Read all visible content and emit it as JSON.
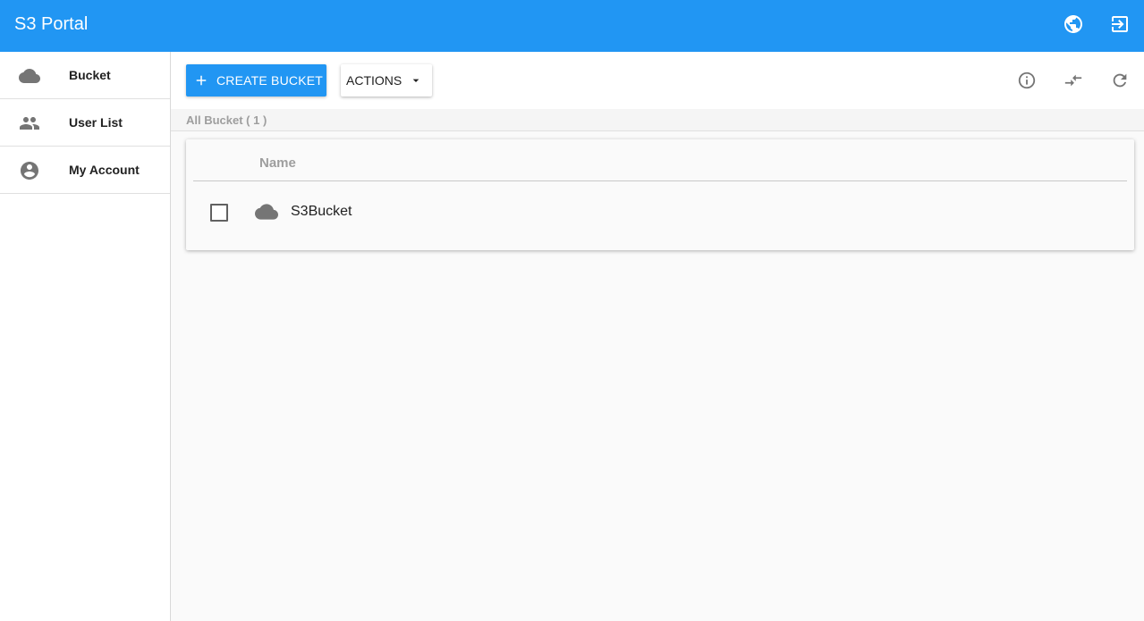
{
  "app": {
    "title": "S3 Portal"
  },
  "topbar": {
    "icons": [
      {
        "name": "globe-icon"
      },
      {
        "name": "logout-icon"
      }
    ]
  },
  "sidebar": {
    "items": [
      {
        "label": "Bucket",
        "icon": "cloud-icon"
      },
      {
        "label": "User List",
        "icon": "people-icon"
      },
      {
        "label": "My Account",
        "icon": "account-circle-icon"
      }
    ]
  },
  "toolbar": {
    "create_label": "CREATE BUCKET",
    "actions_label": "ACTIONS",
    "right_icons": [
      "info-icon",
      "compare-arrows-icon",
      "refresh-icon"
    ]
  },
  "list": {
    "count_label": "All Bucket ( 1 )",
    "columns": [
      "Name"
    ],
    "rows": [
      {
        "name": "S3Bucket",
        "icon": "cloud-icon",
        "checked": false
      }
    ]
  },
  "colors": {
    "primary": "#2196f3",
    "icon_gray": "#757575",
    "muted_text": "#9e9e9e"
  }
}
